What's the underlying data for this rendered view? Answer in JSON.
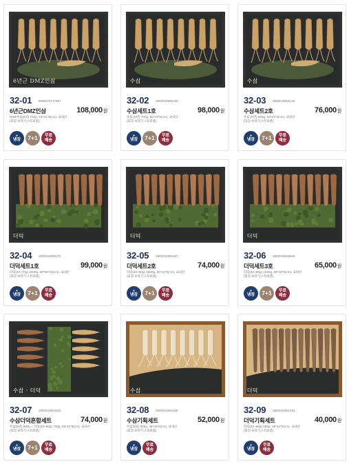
{
  "colors": {
    "code": "#1d2d57",
    "cold": "#1f3d6d",
    "combo": "#9b8471",
    "free": "#8c2e3f"
  },
  "icons": {
    "cold": "water-drop-icon"
  },
  "products": [
    {
      "code": "32-01",
      "barcode": "8809376717597",
      "name": "6년근DMZ인삼",
      "price": "108,000",
      "currency": "원",
      "desc": [
        "DMZ수삼(6년) 750g, 53*41*9(cm), 국내산",
        "(포장:보자기,스티로폼)"
      ],
      "brand": "6년근 DMZ인삼",
      "brand_sub": "",
      "root": "ginseng",
      "tray": "black",
      "badges": {
        "cold_drop": "●",
        "cold": "냉장",
        "combo": "7+1",
        "free1": "무료",
        "free2": "배송"
      },
      "badge_set": [
        "cold",
        "combo",
        "free"
      ]
    },
    {
      "code": "32-02",
      "barcode": "2800043906132",
      "name": "수삼세트1호",
      "price": "98,000",
      "currency": "원",
      "desc": [
        "수삼 (5년) 700g, 56*44*9(cm), 국내산",
        "(포장:보자기,스티로폼)"
      ],
      "brand": "수삼",
      "brand_sub": "",
      "root": "ginseng",
      "tray": "black",
      "badges": {
        "cold_drop": "●",
        "cold": "냉장",
        "combo": "7+1",
        "free1": "무료",
        "free2": "배송"
      },
      "badge_set": [
        "cold",
        "combo",
        "free"
      ]
    },
    {
      "code": "32-03",
      "barcode": "2800043906149",
      "name": "수삼세트2호",
      "price": "76,000",
      "currency": "원",
      "desc": [
        "수삼 (5년) 550g, 53*41*9(cm), 국내산",
        "(포장:보자기,스티로폼)"
      ],
      "brand": "수삼",
      "brand_sub": "",
      "root": "ginseng",
      "tray": "black",
      "badges": {
        "cold_drop": "●",
        "cold": "냉장",
        "combo": "7+1",
        "free1": "무료",
        "free2": "배송"
      },
      "badge_set": [
        "cold",
        "combo",
        "free"
      ]
    },
    {
      "code": "32-04",
      "barcode": "2800043906170",
      "name": "더덕세트1호",
      "price": "99,000",
      "currency": "원",
      "desc": [
        "더덕(40~70g) 2000g, 58*56*10(cm), 국내산",
        "(포장:보자기,스티로폼)"
      ],
      "brand": "더덕",
      "brand_sub": "",
      "root": "deodeok",
      "tray": "black",
      "badges": {
        "cold_drop": "●",
        "cold": "냉장",
        "combo": "7+1",
        "free1": "무료",
        "free2": "배송"
      },
      "badge_set": [
        "cold",
        "combo",
        "free"
      ]
    },
    {
      "code": "32-05",
      "barcode": "2800043906187",
      "name": "더덕세트2호",
      "price": "74,000",
      "currency": "원",
      "desc": [
        "더덕(40~80g) 1500g, 56*44*9(cm), 국내산",
        "(포장:보자기,스티로폼)"
      ],
      "brand": "더덕",
      "brand_sub": "",
      "root": "deodeok",
      "tray": "black",
      "badges": {
        "cold_drop": "●",
        "cold": "냉장",
        "combo": "7+1",
        "free1": "무료",
        "free2": "배송"
      },
      "badge_set": [
        "cold",
        "combo",
        "free"
      ]
    },
    {
      "code": "32-06",
      "barcode": "2800043906545",
      "name": "더덕세트3호",
      "price": "65,000",
      "currency": "원",
      "desc": [
        "더덕(40~60g) 1200g, 56*44*9(cm), 국내산",
        "(포장:보자기,스티로폼)"
      ],
      "brand": "더덕",
      "brand_sub": "",
      "root": "deodeok",
      "tray": "black",
      "badges": {
        "cold_drop": "●",
        "cold": "냉장",
        "combo": "7+1",
        "free1": "무료",
        "free2": "배송"
      },
      "badge_set": [
        "cold",
        "combo",
        "free"
      ]
    },
    {
      "code": "32-07",
      "barcode": "2800043904200",
      "name": "수삼더덕혼합세트",
      "price": "74,000",
      "currency": "원",
      "desc": [
        "수삼(5년) 800g + 더덕(40~80g) 700g, 58*44*9(cm), 국내산",
        "(포장:보자기,스티로폼)"
      ],
      "brand": "수삼 · 더덕",
      "brand_sub": "",
      "root": "mixed",
      "tray": "black",
      "badges": {
        "cold_drop": "●",
        "cold": "냉장",
        "combo": "7+1",
        "free1": "무료",
        "free2": "배송"
      },
      "badge_set": [
        "cold",
        "combo",
        "free"
      ]
    },
    {
      "code": "32-08",
      "barcode": "2800024902186",
      "name": "수삼기획세트",
      "price": "52,000",
      "currency": "원",
      "desc": [
        "수삼(5년) 500g, 46*34*6(cm), 국내산",
        "(포장:보자기,스티로폼)"
      ],
      "brand": "수삼",
      "brand_sub": "",
      "root": "ginseng-loose",
      "tray": "wood",
      "badges": {
        "cold_drop": "●",
        "cold": "냉장",
        "combo": "",
        "free1": "무료",
        "free2": "배송"
      },
      "badge_set": [
        "cold",
        "free"
      ]
    },
    {
      "code": "32-09",
      "barcode": "2800024902193",
      "name": "더덕기획세트",
      "price": "40,000",
      "currency": "원",
      "desc": [
        "더덕(40~60g) 550g, 46*34*6(cm), 국내산",
        "(포장:보자기,스티로폼)"
      ],
      "brand": "더덕",
      "brand_sub": "",
      "root": "deodeok-loose",
      "tray": "wood",
      "badges": {
        "cold_drop": "●",
        "cold": "냉장",
        "combo": "",
        "free1": "무료",
        "free2": "배송"
      },
      "badge_set": [
        "cold",
        "free"
      ]
    }
  ]
}
